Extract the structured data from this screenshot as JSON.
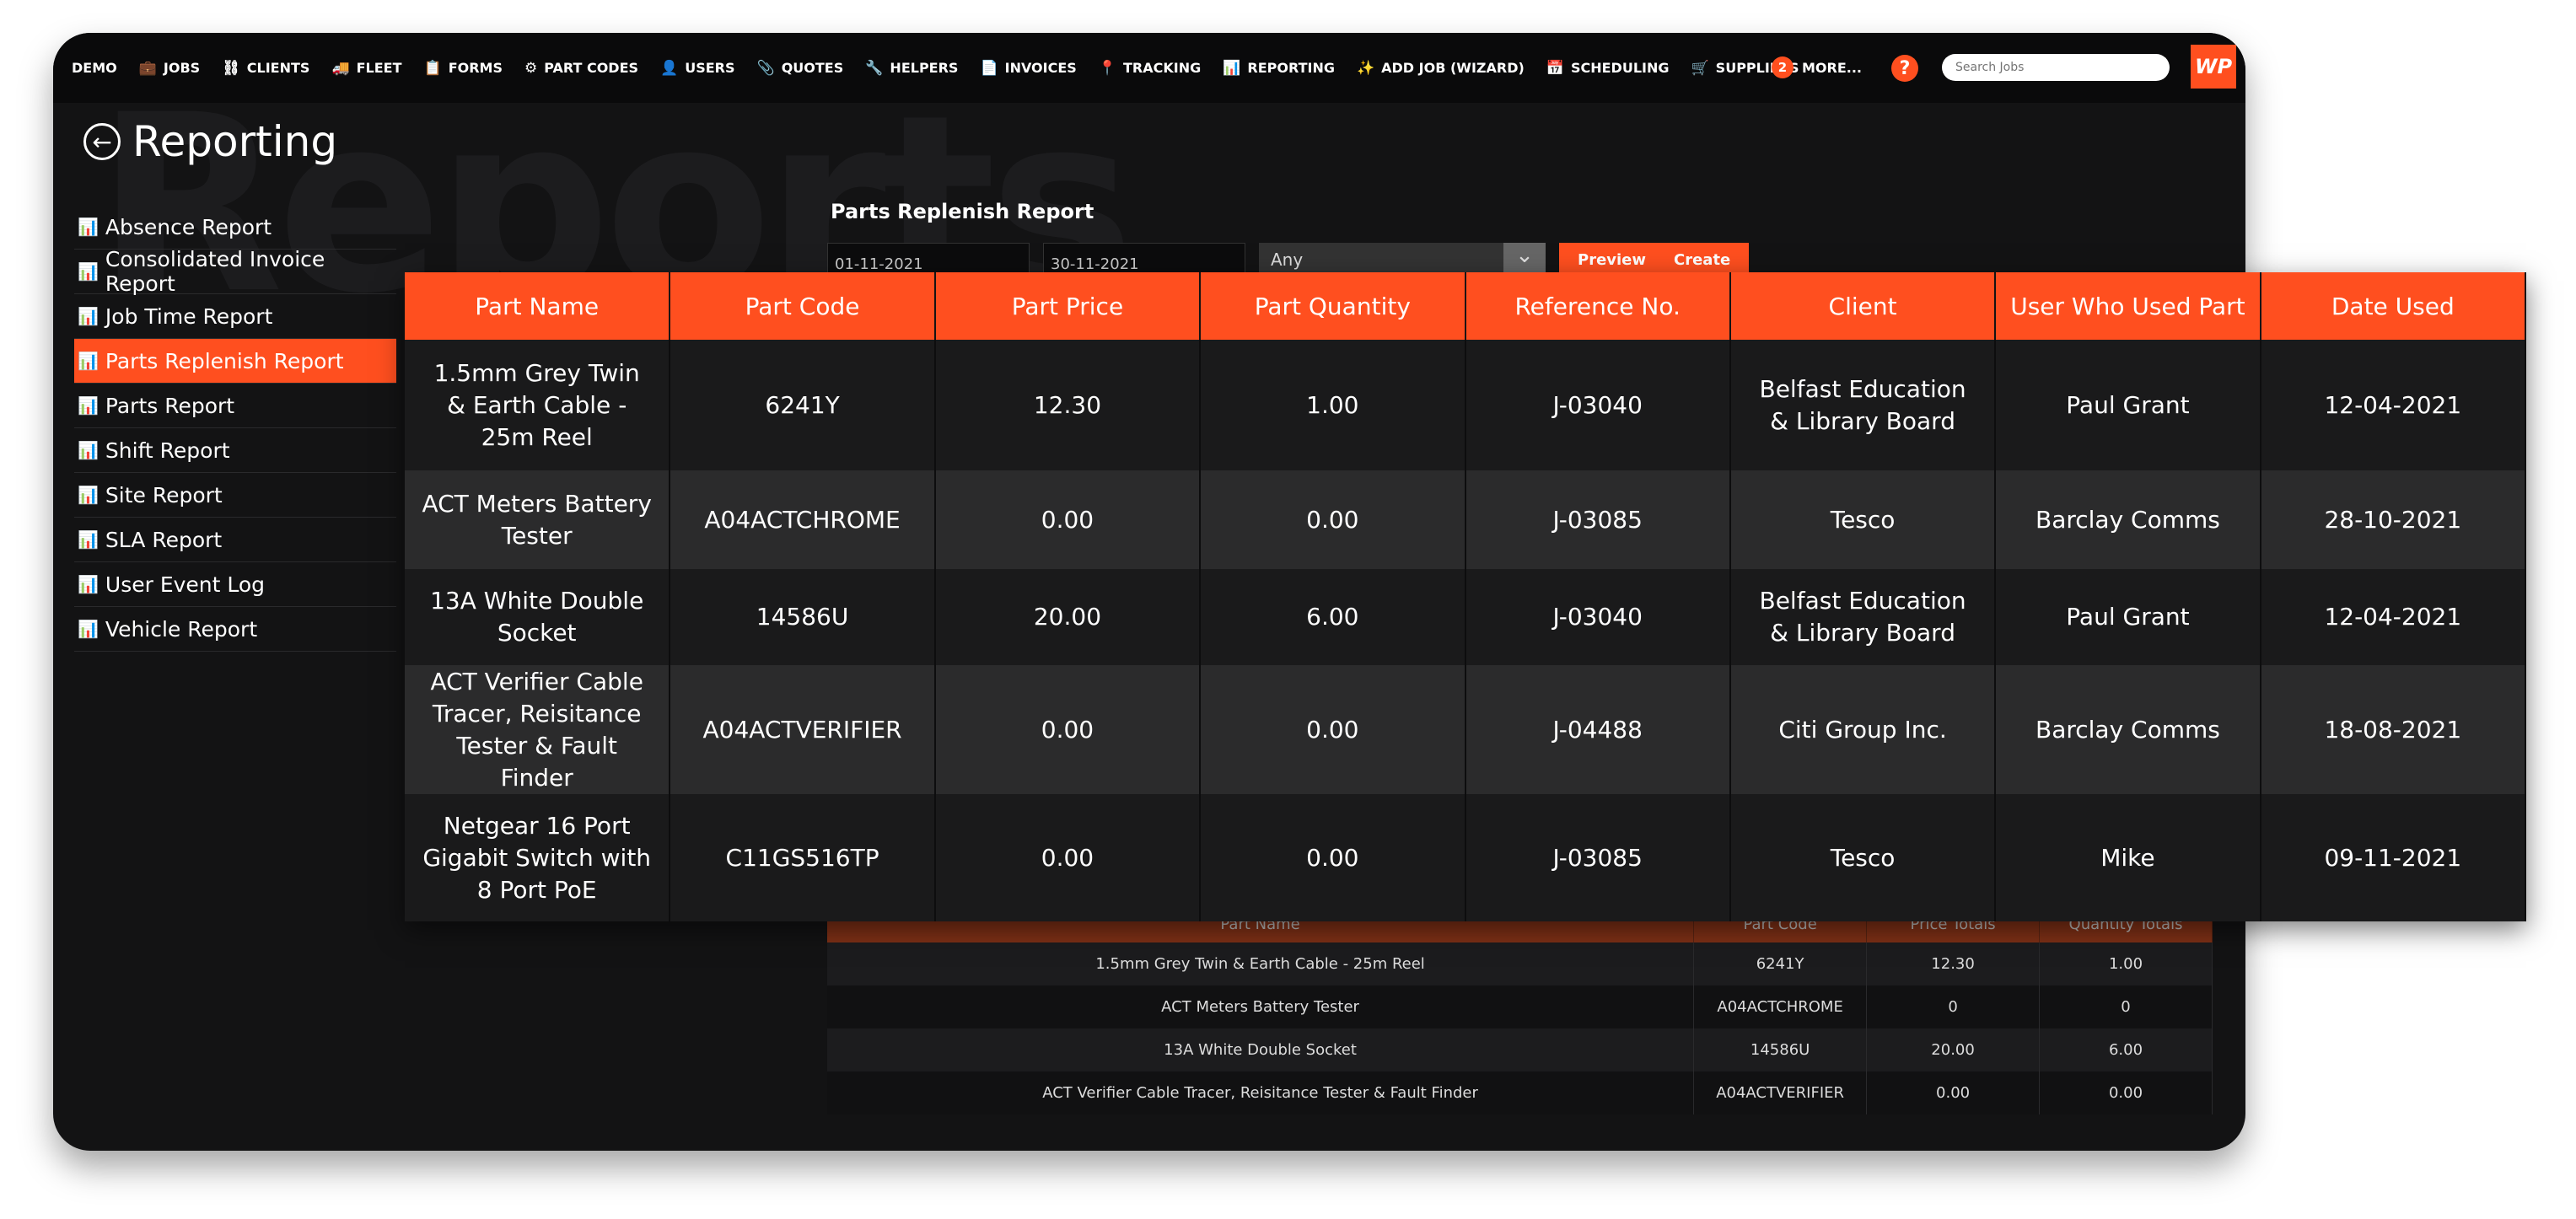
{
  "nav": {
    "brand": "DEMO",
    "items": [
      {
        "label": "JOBS",
        "icon": "💼"
      },
      {
        "label": "CLIENTS",
        "icon": "⛓"
      },
      {
        "label": "FLEET",
        "icon": "🚚"
      },
      {
        "label": "FORMS",
        "icon": "📋"
      },
      {
        "label": "PART CODES",
        "icon": "⚙"
      },
      {
        "label": "USERS",
        "icon": "👤"
      },
      {
        "label": "QUOTES",
        "icon": "📎"
      },
      {
        "label": "HELPERS",
        "icon": "🔧"
      },
      {
        "label": "INVOICES",
        "icon": "📄"
      },
      {
        "label": "TRACKING",
        "icon": "📍"
      },
      {
        "label": "REPORTING",
        "icon": "📊"
      },
      {
        "label": "ADD JOB (WIZARD)",
        "icon": "✨"
      },
      {
        "label": "SCHEDULING",
        "icon": "📅"
      },
      {
        "label": "SUPPLIERS",
        "icon": "🛒"
      }
    ],
    "more_count": "2",
    "more_label": "MORE...",
    "help": "?",
    "search_placeholder": "Search Jobs",
    "logo": "WP"
  },
  "watermark": "Reports",
  "page_title": "Reporting",
  "sidebar": [
    "Absence Report",
    "Consolidated Invoice Report",
    "Job Time Report",
    "Parts Replenish Report",
    "Parts Report",
    "Shift Report",
    "Site Report",
    "SLA Report",
    "User Event Log",
    "Vehicle Report"
  ],
  "sidebar_active": 3,
  "report": {
    "title": "Parts Replenish Report",
    "from": "01-11-2021",
    "to": "30-11-2021",
    "filter": "Any",
    "preview": "Preview",
    "create": "Create"
  },
  "overlay_table": {
    "headers": [
      "Part Name",
      "Part Code",
      "Part Price",
      "Part Quantity",
      "Reference No.",
      "Client",
      "User Who Used Part",
      "Date Used"
    ],
    "rows": [
      [
        "1.5mm Grey Twin & Earth Cable - 25m Reel",
        "6241Y",
        "12.30",
        "1.00",
        "J-03040",
        "Belfast Education & Library Board",
        "Paul Grant",
        "12-04-2021"
      ],
      [
        "ACT Meters Battery Tester",
        "A04ACTCHROME",
        "0.00",
        "0.00",
        "J-03085",
        "Tesco",
        "Barclay Comms",
        "28-10-2021"
      ],
      [
        "13A White Double Socket",
        "14586U",
        "20.00",
        "6.00",
        "J-03040",
        "Belfast Education & Library Board",
        "Paul Grant",
        "12-04-2021"
      ],
      [
        "ACT Verifier Cable Tracer, Reisitance Tester & Fault Finder",
        "A04ACTVERIFIER",
        "0.00",
        "0.00",
        "J-04488",
        "Citi Group Inc.",
        "Barclay Comms",
        "18-08-2021"
      ],
      [
        "Netgear 16 Port Gigabit Switch with 8 Port PoE",
        "C11GS516TP",
        "0.00",
        "0.00",
        "J-03085",
        "Tesco",
        "Mike",
        "09-11-2021"
      ]
    ]
  },
  "totals_table": {
    "headers": [
      "Part Name",
      "Part Code",
      "Price Totals",
      "Quantity Totals"
    ],
    "rows": [
      [
        "1.5mm Grey Twin & Earth Cable - 25m Reel",
        "6241Y",
        "12.30",
        "1.00"
      ],
      [
        "ACT Meters Battery Tester",
        "A04ACTCHROME",
        "0",
        "0"
      ],
      [
        "13A White Double Socket",
        "14586U",
        "20.00",
        "6.00"
      ],
      [
        "ACT Verifier Cable Tracer, Reisitance Tester & Fault Finder",
        "A04ACTVERIFIER",
        "0.00",
        "0.00"
      ]
    ]
  },
  "colors": {
    "accent": "#ff4f1f",
    "background": "#131314"
  }
}
